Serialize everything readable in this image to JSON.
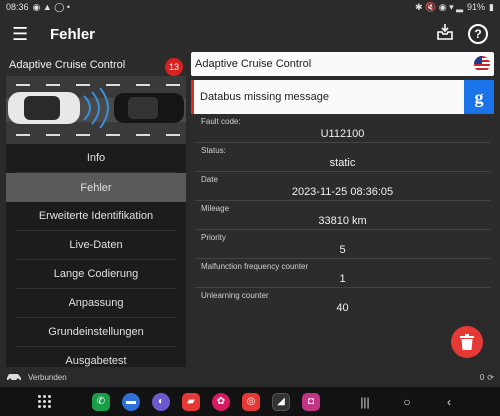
{
  "status_bar": {
    "time": "08:36",
    "battery": "91%"
  },
  "app_bar": {
    "title": "Fehler",
    "menu_icon": "hamburger-menu-icon",
    "inbox_icon": "inbox-download-icon",
    "help_icon": "help-icon"
  },
  "module": {
    "name": "Adaptive Cruise Control",
    "badge_count": "13"
  },
  "nav": {
    "items": [
      {
        "label": "Info",
        "active": false
      },
      {
        "label": "Fehler",
        "active": true
      },
      {
        "label": "Erweiterte Identifikation",
        "active": false
      },
      {
        "label": "Live-Daten",
        "active": false
      },
      {
        "label": "Lange Codierung",
        "active": false
      },
      {
        "label": "Anpassung",
        "active": false
      },
      {
        "label": "Grundeinstellungen",
        "active": false
      },
      {
        "label": "Ausgabetest",
        "active": false
      }
    ]
  },
  "detail": {
    "module_name": "Adaptive Cruise Control",
    "error_message": "Databus missing message",
    "google_button": "g",
    "fields": [
      {
        "label": "Fault code:",
        "value": "U112100"
      },
      {
        "label": "Status:",
        "value": "static"
      },
      {
        "label": "Date",
        "value": "2023-11-25 08:36:05"
      },
      {
        "label": "Mileage",
        "value": "33810 km"
      },
      {
        "label": "Priority",
        "value": "5"
      },
      {
        "label": "Malfunction frequency counter",
        "value": "1"
      },
      {
        "label": "Unlearning counter",
        "value": "40"
      }
    ]
  },
  "connection": {
    "label": "Verbunden",
    "counter": "0"
  },
  "colors": {
    "accent_red": "#e53935",
    "badge_red": "#d92121",
    "google_blue": "#1a73e8"
  }
}
